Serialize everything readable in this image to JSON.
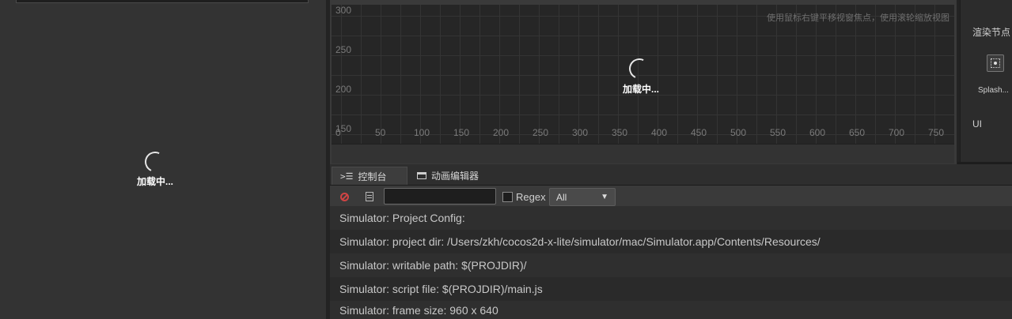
{
  "colors": {
    "accent_error": "#d04444",
    "panel_bg": "#333333",
    "scene_bg": "#262626"
  },
  "left_panel": {
    "loading_text": "加载中..."
  },
  "scene": {
    "hint": "使用鼠标右键平移视窗焦点，使用滚轮缩放视图",
    "loading_text": "加载中...",
    "y_labels": [
      "300",
      "250",
      "200",
      "150"
    ],
    "x_labels": [
      "0",
      "50",
      "100",
      "150",
      "200",
      "250",
      "300",
      "350",
      "400",
      "450",
      "500",
      "550",
      "600",
      "650",
      "700",
      "750"
    ]
  },
  "right_panel": {
    "title": "渲染节点",
    "node_label": "Splash...",
    "node_icon": "node-icon",
    "section_label": "UI"
  },
  "tabs": [
    {
      "label": "控制台",
      "icon": "console-icon",
      "active": true
    },
    {
      "label": "动画编辑器",
      "icon": "animation-icon",
      "active": false
    }
  ],
  "toolbar": {
    "clear_icon": "clear-icon",
    "file_icon": "file-icon",
    "filter_value": "",
    "regex_label": "Regex",
    "level_selected": "All"
  },
  "console": {
    "lines": [
      "Simulator: Project Config:",
      "Simulator: project dir: /Users/zkh/cocos2d-x-lite/simulator/mac/Simulator.app/Contents/Resources/",
      "Simulator: writable path: $(PROJDIR)/",
      "Simulator: script file: $(PROJDIR)/main.js",
      "Simulator: frame size: 960 x 640"
    ]
  }
}
